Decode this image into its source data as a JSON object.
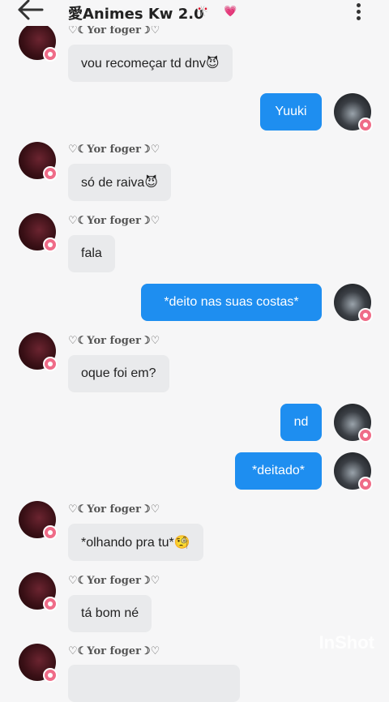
{
  "header": {
    "title": "愛Animes Kw 2.0",
    "deco_1": "🎌",
    "deco_2": "💗"
  },
  "messages": [
    {
      "sender": "♡☾Yor foger☽♡",
      "text": "vou recomeçar td dnv😈"
    },
    {
      "sender": "me",
      "text": "Yuuki"
    },
    {
      "sender": "♡☾Yor foger☽♡",
      "text": "só de raiva😈"
    },
    {
      "sender": "♡☾Yor foger☽♡",
      "text": "fala"
    },
    {
      "sender": "me",
      "text": "*deito nas suas costas*"
    },
    {
      "sender": "♡☾Yor foger☽♡",
      "text": "oque foi em?"
    },
    {
      "sender": "me",
      "text": "nd"
    },
    {
      "sender": "me",
      "text": "*deitado*"
    },
    {
      "sender": "♡☾Yor foger☽♡",
      "text": "*olhando pra tu*🧐"
    },
    {
      "sender": "♡☾Yor foger☽♡",
      "text": "tá bom né"
    },
    {
      "sender": "♡☾Yor foger☽♡",
      "text": ""
    }
  ],
  "names": {
    "yor": "♡☾Yor foger☽♡"
  },
  "watermark": "InShot"
}
